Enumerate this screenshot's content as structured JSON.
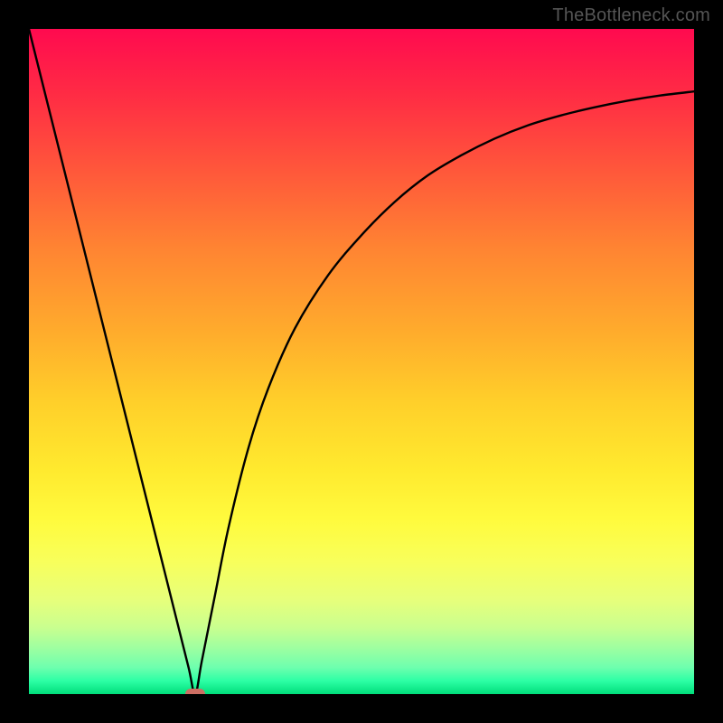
{
  "watermark": "TheBottleneck.com",
  "chart_data": {
    "type": "line",
    "title": "",
    "xlabel": "",
    "ylabel": "",
    "xlim": [
      0,
      100
    ],
    "ylim": [
      0,
      100
    ],
    "grid": false,
    "legend": false,
    "series": [
      {
        "name": "bottleneck-curve",
        "x": [
          0,
          5,
          10,
          15,
          20,
          22,
          24,
          25,
          26,
          28,
          30,
          33,
          36,
          40,
          45,
          50,
          55,
          60,
          65,
          70,
          75,
          80,
          85,
          90,
          95,
          100
        ],
        "values": [
          100,
          80,
          60,
          40,
          20,
          12,
          4,
          0,
          5,
          15,
          25,
          37,
          46,
          55,
          63,
          69,
          74,
          78,
          81,
          83.5,
          85.5,
          87,
          88.2,
          89.2,
          90,
          90.6
        ]
      }
    ],
    "marker": {
      "x": 25,
      "y": 0,
      "color": "#cc6e63"
    },
    "gradient_stops": [
      {
        "pos": 0,
        "color": "#ff0a4f"
      },
      {
        "pos": 10,
        "color": "#ff2c44"
      },
      {
        "pos": 22,
        "color": "#ff5a3a"
      },
      {
        "pos": 33,
        "color": "#ff8432"
      },
      {
        "pos": 46,
        "color": "#ffad2c"
      },
      {
        "pos": 56,
        "color": "#ffcf2a"
      },
      {
        "pos": 66,
        "color": "#ffe92e"
      },
      {
        "pos": 74,
        "color": "#fffb3e"
      },
      {
        "pos": 80,
        "color": "#f8ff5b"
      },
      {
        "pos": 86,
        "color": "#e6ff7c"
      },
      {
        "pos": 90,
        "color": "#c9ff8f"
      },
      {
        "pos": 93,
        "color": "#9fffa0"
      },
      {
        "pos": 96,
        "color": "#6effae"
      },
      {
        "pos": 98,
        "color": "#2dffa5"
      },
      {
        "pos": 100,
        "color": "#00de7b"
      }
    ]
  }
}
